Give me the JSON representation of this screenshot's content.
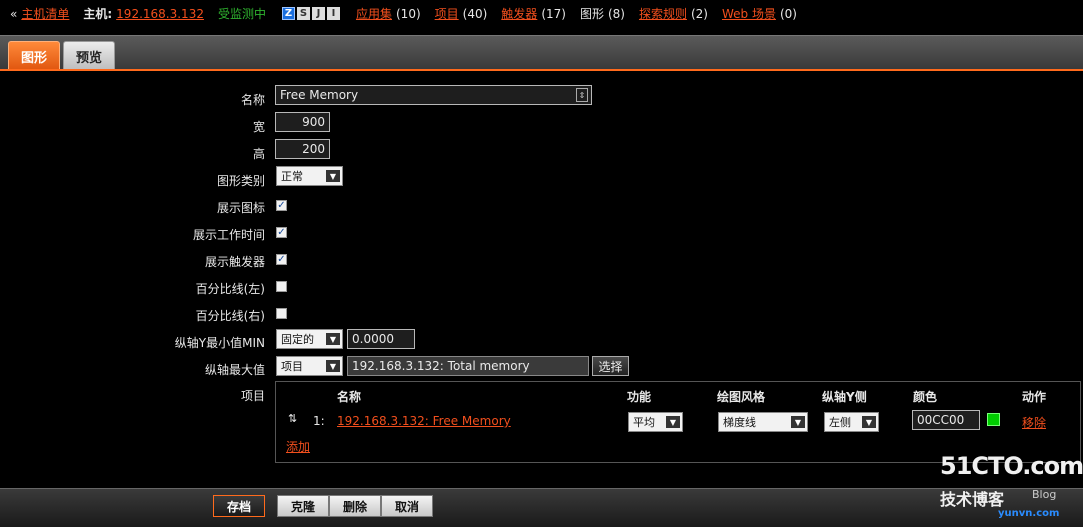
{
  "topbar": {
    "back_arrow": "«",
    "host_list": "主机清单",
    "host_label": "主机:",
    "host_ip": "192.168.3.132",
    "status": "受监测中",
    "availability": [
      "Z",
      "S",
      "J",
      "I"
    ],
    "links": [
      {
        "label": "应用集",
        "count": "(10)"
      },
      {
        "label": "项目",
        "count": "(40)"
      },
      {
        "label": "触发器",
        "count": "(17)"
      }
    ],
    "graphs_label": "图形",
    "graphs_count": "(8)",
    "links2": [
      {
        "label": "探索规则",
        "count": "(2)"
      },
      {
        "label": "Web 场景",
        "count": "(0)"
      }
    ]
  },
  "tabs": {
    "graph": "图形",
    "preview": "预览"
  },
  "form": {
    "name_label": "名称",
    "name_value": "Free Memory",
    "width_label": "宽",
    "width_value": "900",
    "height_label": "高",
    "height_value": "200",
    "type_label": "图形类别",
    "type_value": "正常",
    "show_legend_label": "展示图标",
    "show_worktime_label": "展示工作时间",
    "show_triggers_label": "展示触发器",
    "percentile_left_label": "百分比线(左)",
    "percentile_right_label": "百分比线(右)",
    "ymin_label": "纵轴Y最小值MIN",
    "ymin_type": "固定的",
    "ymin_value": "0.0000",
    "ymax_label": "纵轴最大值",
    "ymax_type": "项目",
    "ymax_value": "192.168.3.132: Total memory",
    "ymax_select": "选择",
    "items_label": "项目"
  },
  "items_table": {
    "headers": {
      "name": "名称",
      "function": "功能",
      "style": "绘图风格",
      "yaxis": "纵轴Y侧",
      "color": "颜色",
      "action": "动作"
    },
    "rows": [
      {
        "index": "1:",
        "name": "192.168.3.132: Free Memory",
        "function": "平均",
        "style": "梯度线",
        "yaxis": "左侧",
        "color": "00CC00",
        "action": "移除"
      }
    ],
    "add": "添加"
  },
  "footer": {
    "save": "存档",
    "clone": "克隆",
    "delete": "删除",
    "cancel": "取消"
  },
  "watermark": {
    "line1": "51CTO.com",
    "line2": "技术博客",
    "line3": "Blog",
    "line4": "yunvn.com"
  },
  "colors": {
    "accent": "#ff6a1c",
    "link": "#f24f1d",
    "status_green": "#2fb52f",
    "item_color": "#00cc00"
  }
}
